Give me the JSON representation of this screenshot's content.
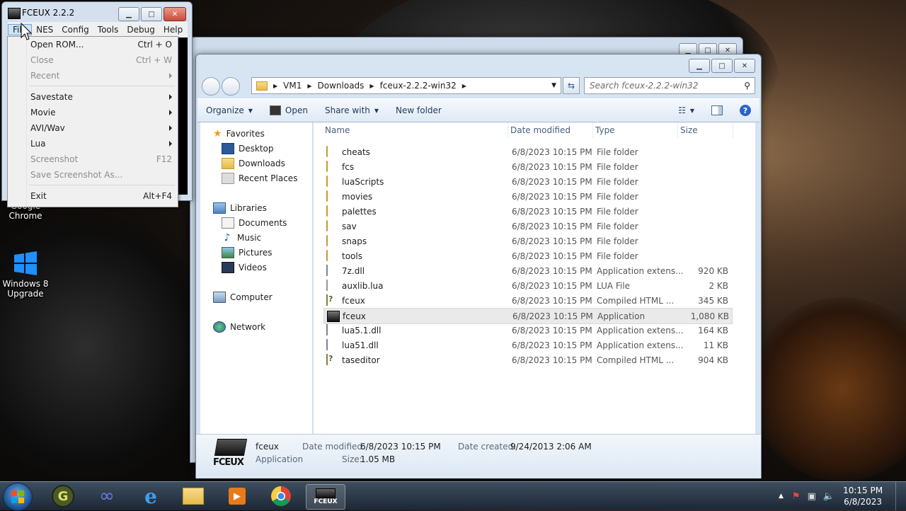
{
  "desktop": {
    "icons": [
      {
        "label_line1": "Google",
        "label_line2": "Chrome",
        "icon": "chrome-icon"
      },
      {
        "label_line1": "Windows 8",
        "label_line2": "Upgrade",
        "icon": "windows-logo-icon"
      }
    ]
  },
  "fceux": {
    "title": "FCEUX 2.2.2",
    "menus": [
      "File",
      "NES",
      "Config",
      "Tools",
      "Debug",
      "Help"
    ],
    "file_menu": [
      {
        "label": "Open ROM...",
        "shortcut": "Ctrl + O",
        "disabled": false
      },
      {
        "label": "Close",
        "shortcut": "Ctrl + W",
        "disabled": true
      },
      {
        "label": "Recent",
        "shortcut": "",
        "disabled": true,
        "submenu": true
      },
      {
        "label": "Savestate",
        "shortcut": "",
        "disabled": false,
        "submenu": true
      },
      {
        "label": "Movie",
        "shortcut": "",
        "disabled": false,
        "submenu": true
      },
      {
        "label": "AVI/Wav",
        "shortcut": "",
        "disabled": false,
        "submenu": true
      },
      {
        "label": "Lua",
        "shortcut": "",
        "disabled": false,
        "submenu": true
      },
      {
        "label": "Screenshot",
        "shortcut": "F12",
        "disabled": true
      },
      {
        "label": "Save Screenshot As...",
        "shortcut": "",
        "disabled": true
      },
      {
        "label": "Exit",
        "shortcut": "Alt+F4",
        "disabled": false
      }
    ]
  },
  "explorer": {
    "breadcrumb": [
      "VM1",
      "Downloads",
      "fceux-2.2.2-win32"
    ],
    "search_placeholder": "Search fceux-2.2.2-win32",
    "toolbar": {
      "organize": "Organize",
      "open": "Open",
      "share_with": "Share with",
      "new_folder": "New folder"
    },
    "nav": {
      "favorites": "Favorites",
      "favorites_items": [
        "Desktop",
        "Downloads",
        "Recent Places"
      ],
      "libraries": "Libraries",
      "libraries_items": [
        "Documents",
        "Music",
        "Pictures",
        "Videos"
      ],
      "computer": "Computer",
      "network": "Network"
    },
    "columns": {
      "name": "Name",
      "date": "Date modified",
      "type": "Type",
      "size": "Size"
    },
    "files": [
      {
        "name": "cheats",
        "date": "6/8/2023 10:15 PM",
        "type": "File folder",
        "size": "",
        "kind": "folder"
      },
      {
        "name": "fcs",
        "date": "6/8/2023 10:15 PM",
        "type": "File folder",
        "size": "",
        "kind": "folder"
      },
      {
        "name": "luaScripts",
        "date": "6/8/2023 10:15 PM",
        "type": "File folder",
        "size": "",
        "kind": "folder"
      },
      {
        "name": "movies",
        "date": "6/8/2023 10:15 PM",
        "type": "File folder",
        "size": "",
        "kind": "folder"
      },
      {
        "name": "palettes",
        "date": "6/8/2023 10:15 PM",
        "type": "File folder",
        "size": "",
        "kind": "folder"
      },
      {
        "name": "sav",
        "date": "6/8/2023 10:15 PM",
        "type": "File folder",
        "size": "",
        "kind": "folder"
      },
      {
        "name": "snaps",
        "date": "6/8/2023 10:15 PM",
        "type": "File folder",
        "size": "",
        "kind": "folder"
      },
      {
        "name": "tools",
        "date": "6/8/2023 10:15 PM",
        "type": "File folder",
        "size": "",
        "kind": "folder"
      },
      {
        "name": "7z.dll",
        "date": "6/8/2023 10:15 PM",
        "type": "Application extens...",
        "size": "920 KB",
        "kind": "dll"
      },
      {
        "name": "auxlib.lua",
        "date": "6/8/2023 10:15 PM",
        "type": "LUA File",
        "size": "2 KB",
        "kind": "file"
      },
      {
        "name": "fceux",
        "date": "6/8/2023 10:15 PM",
        "type": "Compiled HTML ...",
        "size": "345 KB",
        "kind": "chm"
      },
      {
        "name": "fceux",
        "date": "6/8/2023 10:15 PM",
        "type": "Application",
        "size": "1,080 KB",
        "kind": "app",
        "selected": true
      },
      {
        "name": "lua5.1.dll",
        "date": "6/8/2023 10:15 PM",
        "type": "Application extens...",
        "size": "164 KB",
        "kind": "dll"
      },
      {
        "name": "lua51.dll",
        "date": "6/8/2023 10:15 PM",
        "type": "Application extens...",
        "size": "11 KB",
        "kind": "dll"
      },
      {
        "name": "taseditor",
        "date": "6/8/2023 10:15 PM",
        "type": "Compiled HTML ...",
        "size": "904 KB",
        "kind": "chm"
      }
    ],
    "details": {
      "name": "fceux",
      "type": "Application",
      "date_modified_label": "Date modified:",
      "date_modified": "6/8/2023 10:15 PM",
      "date_created_label": "Date created:",
      "date_created": "9/24/2013 2:06 AM",
      "size_label": "Size:",
      "size": "1.05 MB",
      "logo_text": "FCEUX"
    }
  },
  "taskbar": {
    "clock_time": "10:15 PM",
    "clock_date": "6/8/2023",
    "fceux_label": "FCEUX"
  }
}
